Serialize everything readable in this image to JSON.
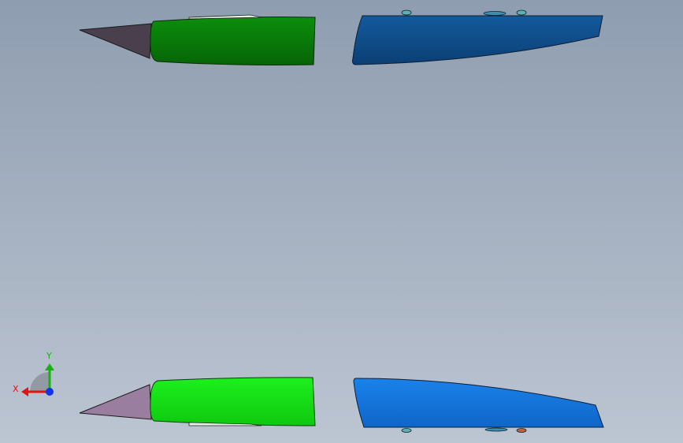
{
  "viewport": {
    "background_top": "#8e9db0",
    "background_bottom": "#bcc5d2"
  },
  "parts": {
    "top": {
      "nose_color": "#4a3f4c",
      "body_color": "#0a7d0a",
      "tail_color": "#0f4f8c"
    },
    "bottom": {
      "nose_color": "#9a7ea0",
      "body_color": "#16e016",
      "tail_color": "#1577dd"
    }
  },
  "triad": {
    "x_label": "X",
    "y_label": "Y",
    "x_color": "#e01414",
    "y_color": "#18b018",
    "z_color": "#1432e6"
  }
}
